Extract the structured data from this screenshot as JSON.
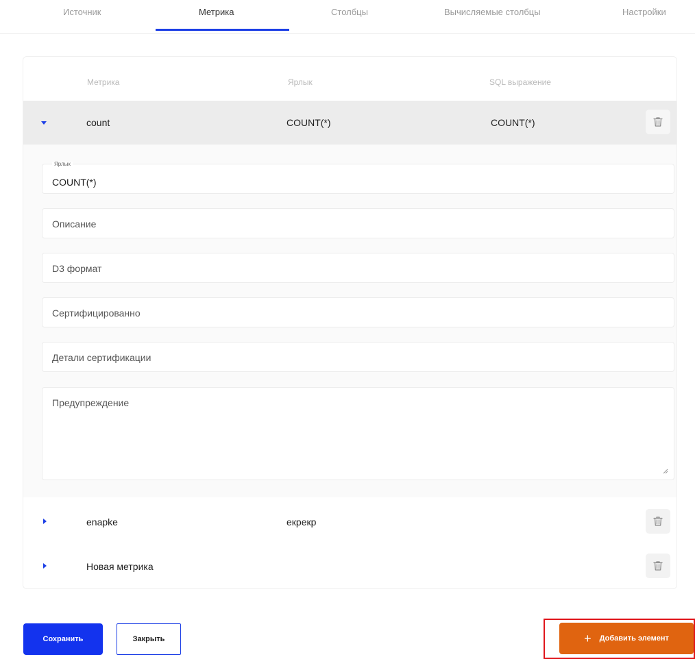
{
  "tabs": [
    {
      "label": "Источник"
    },
    {
      "label": "Метрика"
    },
    {
      "label": "Столбцы"
    },
    {
      "label": "Вычисляемые столбцы"
    },
    {
      "label": "Настройки"
    }
  ],
  "active_tab": "Метрика",
  "table": {
    "headers": [
      "Метрика",
      "Ярлык",
      "SQL выражение"
    ],
    "rows": [
      {
        "metric": "count",
        "label": "COUNT(*)",
        "sql": "COUNT(*)",
        "expanded": true
      },
      {
        "metric": "enapke",
        "label": "екрекр",
        "sql": "",
        "expanded": false
      },
      {
        "metric": "Новая метрика",
        "label": "",
        "sql": "",
        "expanded": false
      }
    ]
  },
  "form": {
    "label_field": {
      "label": "Ярлык",
      "value": "COUNT(*)"
    },
    "description_placeholder": "Описание",
    "d3_format_placeholder": "D3 формат",
    "certified_placeholder": "Сертифицированно",
    "certification_details_placeholder": "Детали сертификации",
    "warning_placeholder": "Предупреждение"
  },
  "footer": {
    "save_label": "Сохранить",
    "close_label": "Закрыть",
    "add_label": "Добавить элемент",
    "add_icon": "+"
  },
  "colors": {
    "accent": "#1c3fe6",
    "save_button": "#1333ee",
    "add_button": "#e06410",
    "highlight": "#e0151b"
  }
}
